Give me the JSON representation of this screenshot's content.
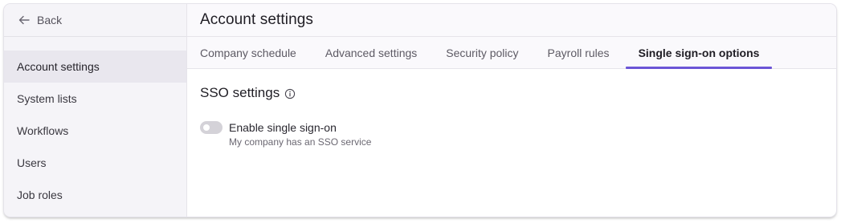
{
  "sidebar": {
    "back_label": "Back",
    "items": [
      {
        "label": "Account settings",
        "active": true
      },
      {
        "label": "System lists",
        "active": false
      },
      {
        "label": "Workflows",
        "active": false
      },
      {
        "label": "Users",
        "active": false
      },
      {
        "label": "Job roles",
        "active": false
      }
    ]
  },
  "header": {
    "title": "Account settings"
  },
  "tabs": [
    {
      "label": "Company schedule",
      "active": false
    },
    {
      "label": "Advanced settings",
      "active": false
    },
    {
      "label": "Security policy",
      "active": false
    },
    {
      "label": "Payroll rules",
      "active": false
    },
    {
      "label": "Single sign-on options",
      "active": true
    }
  ],
  "sso": {
    "section_title": "SSO settings",
    "toggle_label": "Enable single sign-on",
    "toggle_description": "My company has an SSO service",
    "toggle_on": false
  },
  "colors": {
    "accent": "#6b55d6",
    "sidebar_bg": "#f5f4f8",
    "active_item_bg": "#e9e7ee"
  },
  "icons": {
    "back": "arrow-left-icon",
    "info": "info-circle-icon"
  }
}
